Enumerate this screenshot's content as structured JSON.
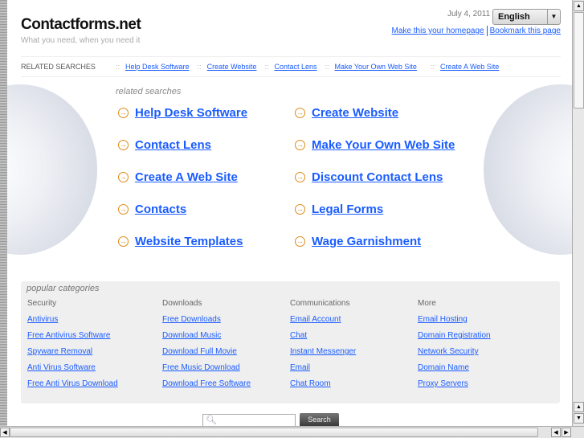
{
  "header": {
    "logo": "Contactforms.net",
    "tagline": "What you need, when you need it",
    "date": "July 4, 2011",
    "language": "English",
    "homepage_link": "Make this your homepage",
    "bookmark_link": "Bookmark this page"
  },
  "related_bar": {
    "label": "RELATED SEARCHES",
    "separator": "::",
    "links": [
      "Help Desk Software",
      "Create Website",
      "Contact Lens",
      "Make Your Own Web Site",
      "Create A Web Site"
    ]
  },
  "related": {
    "title": "related searches",
    "items": [
      "Help Desk Software",
      "Create Website",
      "Contact Lens",
      "Make Your Own Web Site",
      "Create A Web Site",
      "Discount Contact Lens",
      "Contacts",
      "Legal Forms",
      "Website Templates",
      "Wage Garnishment"
    ]
  },
  "popular": {
    "title": "popular categories",
    "columns": [
      {
        "heading": "Security",
        "links": [
          "Antivirus",
          "Free Antivirus Software",
          "Spyware Removal",
          "Anti Virus Software",
          "Free Anti Virus Download"
        ]
      },
      {
        "heading": "Downloads",
        "links": [
          "Free Downloads",
          "Download Music",
          "Download Full Movie",
          "Free Music Download",
          "Download Free Software"
        ]
      },
      {
        "heading": "Communications",
        "links": [
          "Email Account",
          "Chat",
          "Instant Messenger",
          "Email",
          "Chat Room"
        ]
      },
      {
        "heading": "More",
        "links": [
          "Email Hosting",
          "Domain Registration",
          "Network Security",
          "Domain Name",
          "Proxy Servers"
        ]
      }
    ]
  },
  "search": {
    "value": "",
    "button": "Search"
  }
}
